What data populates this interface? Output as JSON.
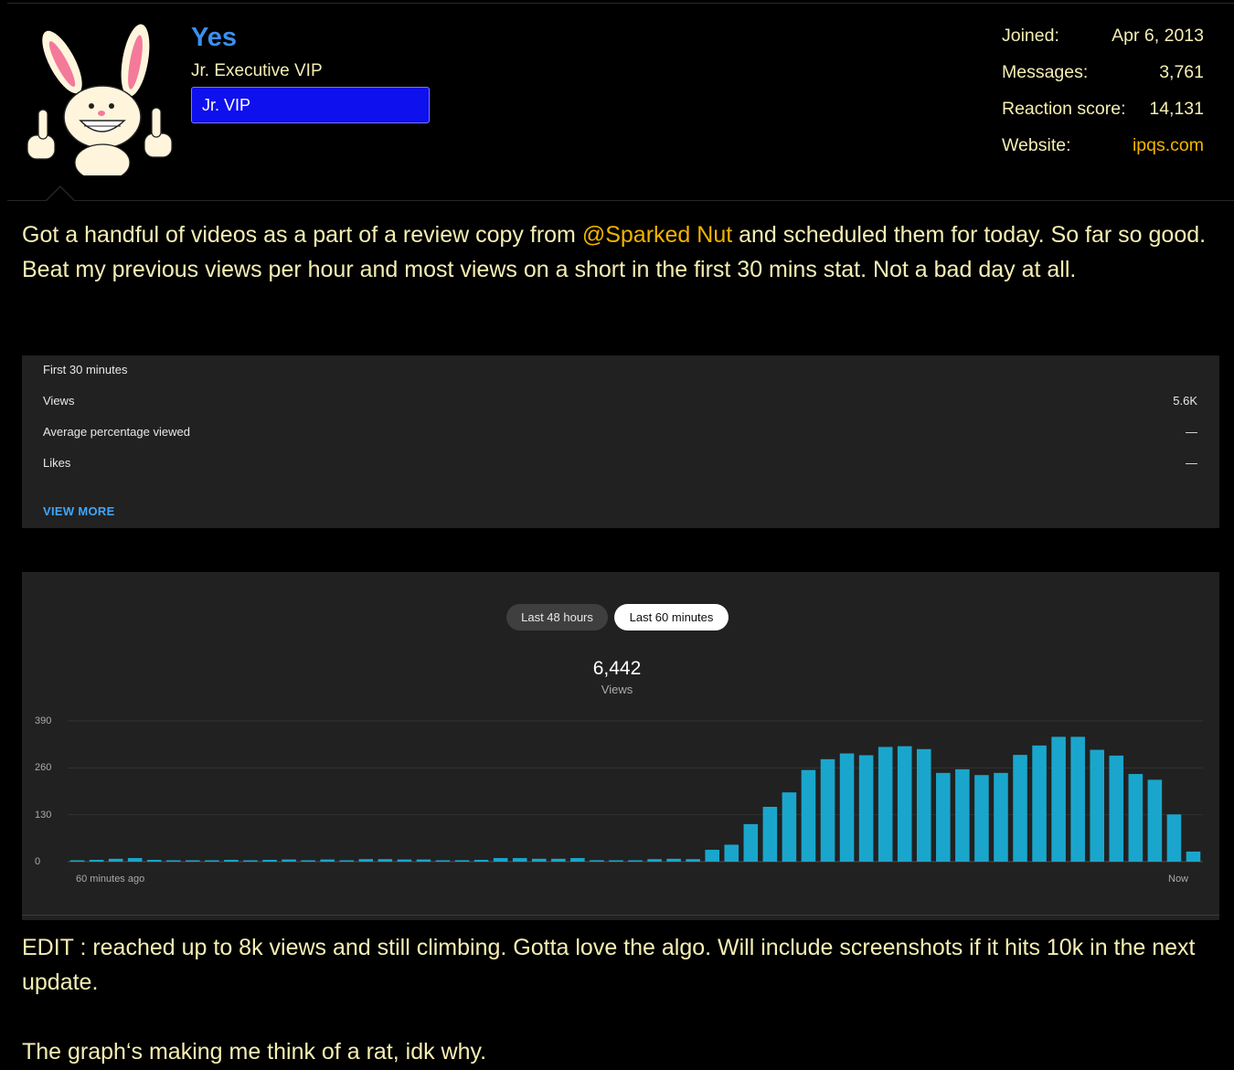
{
  "user": {
    "name": "Yes",
    "title": "Jr. Executive VIP",
    "banner": "Jr. VIP"
  },
  "stats": [
    {
      "label": "Joined:",
      "value": "Apr 6, 2013"
    },
    {
      "label": "Messages:",
      "value": "3,761"
    },
    {
      "label": "Reaction score:",
      "value": "14,131"
    },
    {
      "label": "Website:",
      "value": "ipqs.com"
    }
  ],
  "post": {
    "before_mention": "Got a handful of videos as a part of a review copy from ",
    "mention": "@Sparked Nut",
    "after_mention": " and scheduled them for today. So far so good. Beat my previous views per hour and most views on a short in the first 30 mins stat. Not a bad day at all.",
    "edit": "EDIT : reached up to 8k views and still climbing. Gotta love the algo. Will include screenshots if it hits 10k in the next update.",
    "closing": "The graph‘s making me think of a rat, idk why."
  },
  "first30": {
    "heading": "First 30 minutes",
    "rows": [
      {
        "label": "Views",
        "value": "5.6K"
      },
      {
        "label": "Average percentage viewed",
        "value": "—"
      },
      {
        "label": "Likes",
        "value": "—"
      }
    ],
    "view_more": "VIEW MORE"
  },
  "chart_panel": {
    "tabs": [
      "Last 48 hours",
      "Last 60 minutes"
    ],
    "selected_tab": "Last 60 minutes",
    "total": "6,442",
    "total_label": "Views"
  },
  "chart_data": {
    "type": "bar",
    "y_ticks": [
      "390",
      "260",
      "130",
      "0"
    ],
    "ylim": [
      0,
      390
    ],
    "x_start_label": "60 minutes ago",
    "x_end_label": "Now",
    "color": "#1aa6cc",
    "values": [
      2,
      5,
      8,
      10,
      5,
      3,
      3,
      3,
      5,
      3,
      5,
      6,
      3,
      6,
      2,
      7,
      7,
      6,
      6,
      2,
      4,
      5,
      10,
      10,
      8,
      8,
      10,
      4,
      3,
      3,
      7,
      8,
      7,
      33,
      47,
      104,
      152,
      192,
      254,
      284,
      300,
      295,
      318,
      320,
      312,
      246,
      256,
      240,
      246,
      296,
      322,
      346,
      346,
      310,
      294,
      243,
      227,
      131,
      28
    ]
  },
  "colors": {
    "link": "#3b8ff0",
    "mention": "#f2b400",
    "text": "#f5eeb3",
    "banner": "#0f10ee"
  }
}
